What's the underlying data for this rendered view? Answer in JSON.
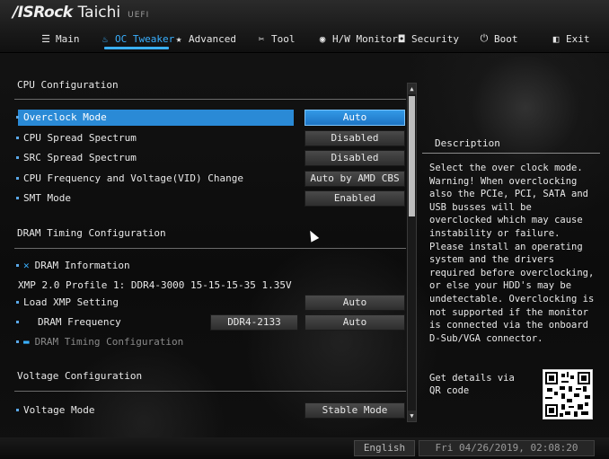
{
  "header": {
    "brand": "/ISRock",
    "model": "Taichi",
    "firmware": "UEFI"
  },
  "tabs": [
    {
      "label": "Main",
      "icon": "list-icon"
    },
    {
      "label": "OC Tweaker",
      "icon": "flame-icon"
    },
    {
      "label": "Advanced",
      "icon": "star-icon"
    },
    {
      "label": "Tool",
      "icon": "tools-icon"
    },
    {
      "label": "H/W Monitor",
      "icon": "monitor-icon"
    },
    {
      "label": "Security",
      "icon": "shield-icon"
    },
    {
      "label": "Boot",
      "icon": "power-icon"
    },
    {
      "label": "Exit",
      "icon": "exit-icon"
    }
  ],
  "active_tab": "OC Tweaker",
  "sections": {
    "cpu": "CPU Configuration",
    "dram": "DRAM Timing Configuration",
    "voltage": "Voltage Configuration"
  },
  "cpu_rows": [
    {
      "label": "Overclock Mode",
      "value": "Auto"
    },
    {
      "label": "CPU Spread Spectrum",
      "value": "Disabled"
    },
    {
      "label": "SRC Spread Spectrum",
      "value": "Disabled"
    },
    {
      "label": "CPU Frequency and Voltage(VID) Change",
      "value": "Auto by AMD CBS"
    },
    {
      "label": "SMT Mode",
      "value": "Enabled"
    }
  ],
  "dram": {
    "info_label": "DRAM Information",
    "xmp_profile": "XMP 2.0 Profile 1: DDR4-3000 15-15-15-35 1.35V",
    "load_xmp_label": "Load XMP Setting",
    "load_xmp_value": "Auto",
    "freq_label": "DRAM Frequency",
    "freq_current": "DDR4-2133",
    "freq_value": "Auto",
    "timing_label": "DRAM Timing Configuration"
  },
  "voltage": {
    "mode_label": "Voltage Mode",
    "mode_value": "Stable Mode"
  },
  "description": {
    "title": "Description",
    "body": "Select the over clock mode. Warning! When overclocking also the PCIe, PCI, SATA and USB busses will be overclocked which may cause instability or failure. Please install an operating system and the drivers required before overclocking, or else your HDD's may be undetectable. Overclocking is not supported if the monitor is connected via the onboard D-Sub/VGA connector."
  },
  "qr_text": "Get details via QR code",
  "footer": {
    "language": "English",
    "datetime": "Fri 04/26/2019, 02:08:20"
  },
  "colors": {
    "accent": "#3ab0ff",
    "selected": "#2a8ad6"
  }
}
